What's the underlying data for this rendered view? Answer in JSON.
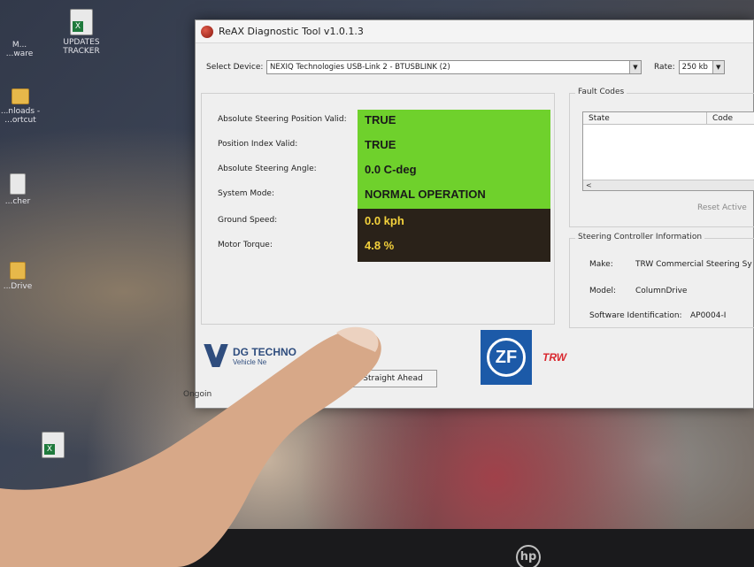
{
  "desktop": {
    "icons": [
      {
        "label": "UPDATES TRACKER",
        "kind": "excel"
      },
      {
        "label": "M... ...ware",
        "kind": "app"
      },
      {
        "label": "...nloads - ...ortcut",
        "kind": "folder"
      },
      {
        "label": "...cher",
        "kind": "doc"
      },
      {
        "label": "...Drive",
        "kind": "folder"
      }
    ],
    "monitor_brand": "hp"
  },
  "window": {
    "title": "ReAX Diagnostic Tool v1.0.1.3"
  },
  "device": {
    "label": "Select Device:",
    "value": "NEXIQ Technologies USB-Link 2 - BTUSBLINK (2)",
    "rate_label": "Rate:",
    "rate_value": "250 kb"
  },
  "status": {
    "labels": [
      "Absolute Steering Position Valid:",
      "Position Index Valid:",
      "Absolute Steering Angle:",
      "System Mode:",
      "Ground Speed:",
      "Motor Torque:"
    ],
    "values": [
      "TRUE",
      "TRUE",
      "0.0 C-deg",
      "NORMAL OPERATION",
      "0.0 kph",
      "4.8 %"
    ],
    "colors": {
      "ok_bg": "#6fd12c",
      "live_bg": "#2a2219",
      "live_text": "#f4d23c"
    }
  },
  "reset_button": "Reset Straight Ahead",
  "fault_codes": {
    "title": "Fault Codes",
    "columns": [
      "State",
      "Code"
    ],
    "scroll_glyph": "<",
    "reset_active": "Reset Active"
  },
  "steering_info": {
    "title": "Steering Controller Information",
    "make_label": "Make:",
    "make_value": "TRW Commercial Steering Sy",
    "model_label": "Model:",
    "model_value": "ColumnDrive",
    "software_label": "Software Identification:",
    "software_value": "AP0004-I"
  },
  "footer": {
    "dg_line1": "DG TECHNO",
    "dg_line2": "Vehicle Ne",
    "zf": "ZF",
    "trw": "TRW",
    "status_text": "Ongoin"
  }
}
